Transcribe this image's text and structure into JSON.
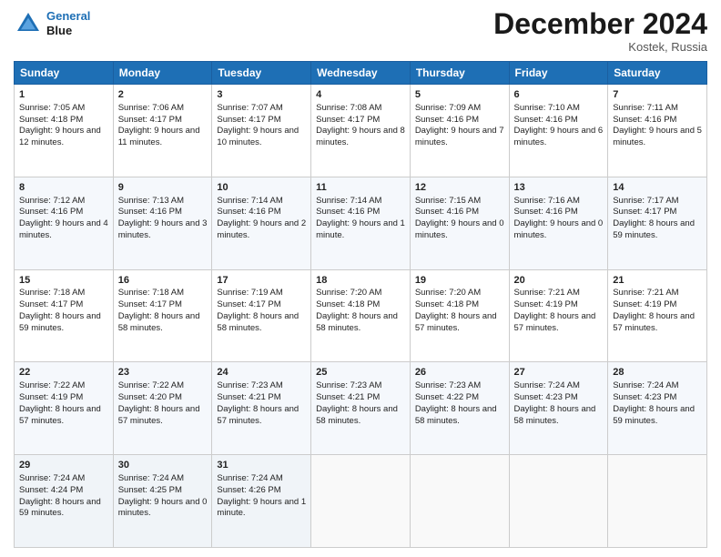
{
  "header": {
    "logo_line1": "General",
    "logo_line2": "Blue",
    "month_title": "December 2024",
    "location": "Kostek, Russia"
  },
  "days_of_week": [
    "Sunday",
    "Monday",
    "Tuesday",
    "Wednesday",
    "Thursday",
    "Friday",
    "Saturday"
  ],
  "weeks": [
    [
      {
        "day": "1",
        "sunrise": "Sunrise: 7:05 AM",
        "sunset": "Sunset: 4:18 PM",
        "daylight": "Daylight: 9 hours and 12 minutes."
      },
      {
        "day": "2",
        "sunrise": "Sunrise: 7:06 AM",
        "sunset": "Sunset: 4:17 PM",
        "daylight": "Daylight: 9 hours and 11 minutes."
      },
      {
        "day": "3",
        "sunrise": "Sunrise: 7:07 AM",
        "sunset": "Sunset: 4:17 PM",
        "daylight": "Daylight: 9 hours and 10 minutes."
      },
      {
        "day": "4",
        "sunrise": "Sunrise: 7:08 AM",
        "sunset": "Sunset: 4:17 PM",
        "daylight": "Daylight: 9 hours and 8 minutes."
      },
      {
        "day": "5",
        "sunrise": "Sunrise: 7:09 AM",
        "sunset": "Sunset: 4:16 PM",
        "daylight": "Daylight: 9 hours and 7 minutes."
      },
      {
        "day": "6",
        "sunrise": "Sunrise: 7:10 AM",
        "sunset": "Sunset: 4:16 PM",
        "daylight": "Daylight: 9 hours and 6 minutes."
      },
      {
        "day": "7",
        "sunrise": "Sunrise: 7:11 AM",
        "sunset": "Sunset: 4:16 PM",
        "daylight": "Daylight: 9 hours and 5 minutes."
      }
    ],
    [
      {
        "day": "8",
        "sunrise": "Sunrise: 7:12 AM",
        "sunset": "Sunset: 4:16 PM",
        "daylight": "Daylight: 9 hours and 4 minutes."
      },
      {
        "day": "9",
        "sunrise": "Sunrise: 7:13 AM",
        "sunset": "Sunset: 4:16 PM",
        "daylight": "Daylight: 9 hours and 3 minutes."
      },
      {
        "day": "10",
        "sunrise": "Sunrise: 7:14 AM",
        "sunset": "Sunset: 4:16 PM",
        "daylight": "Daylight: 9 hours and 2 minutes."
      },
      {
        "day": "11",
        "sunrise": "Sunrise: 7:14 AM",
        "sunset": "Sunset: 4:16 PM",
        "daylight": "Daylight: 9 hours and 1 minute."
      },
      {
        "day": "12",
        "sunrise": "Sunrise: 7:15 AM",
        "sunset": "Sunset: 4:16 PM",
        "daylight": "Daylight: 9 hours and 0 minutes."
      },
      {
        "day": "13",
        "sunrise": "Sunrise: 7:16 AM",
        "sunset": "Sunset: 4:16 PM",
        "daylight": "Daylight: 9 hours and 0 minutes."
      },
      {
        "day": "14",
        "sunrise": "Sunrise: 7:17 AM",
        "sunset": "Sunset: 4:17 PM",
        "daylight": "Daylight: 8 hours and 59 minutes."
      }
    ],
    [
      {
        "day": "15",
        "sunrise": "Sunrise: 7:18 AM",
        "sunset": "Sunset: 4:17 PM",
        "daylight": "Daylight: 8 hours and 59 minutes."
      },
      {
        "day": "16",
        "sunrise": "Sunrise: 7:18 AM",
        "sunset": "Sunset: 4:17 PM",
        "daylight": "Daylight: 8 hours and 58 minutes."
      },
      {
        "day": "17",
        "sunrise": "Sunrise: 7:19 AM",
        "sunset": "Sunset: 4:17 PM",
        "daylight": "Daylight: 8 hours and 58 minutes."
      },
      {
        "day": "18",
        "sunrise": "Sunrise: 7:20 AM",
        "sunset": "Sunset: 4:18 PM",
        "daylight": "Daylight: 8 hours and 58 minutes."
      },
      {
        "day": "19",
        "sunrise": "Sunrise: 7:20 AM",
        "sunset": "Sunset: 4:18 PM",
        "daylight": "Daylight: 8 hours and 57 minutes."
      },
      {
        "day": "20",
        "sunrise": "Sunrise: 7:21 AM",
        "sunset": "Sunset: 4:19 PM",
        "daylight": "Daylight: 8 hours and 57 minutes."
      },
      {
        "day": "21",
        "sunrise": "Sunrise: 7:21 AM",
        "sunset": "Sunset: 4:19 PM",
        "daylight": "Daylight: 8 hours and 57 minutes."
      }
    ],
    [
      {
        "day": "22",
        "sunrise": "Sunrise: 7:22 AM",
        "sunset": "Sunset: 4:19 PM",
        "daylight": "Daylight: 8 hours and 57 minutes."
      },
      {
        "day": "23",
        "sunrise": "Sunrise: 7:22 AM",
        "sunset": "Sunset: 4:20 PM",
        "daylight": "Daylight: 8 hours and 57 minutes."
      },
      {
        "day": "24",
        "sunrise": "Sunrise: 7:23 AM",
        "sunset": "Sunset: 4:21 PM",
        "daylight": "Daylight: 8 hours and 57 minutes."
      },
      {
        "day": "25",
        "sunrise": "Sunrise: 7:23 AM",
        "sunset": "Sunset: 4:21 PM",
        "daylight": "Daylight: 8 hours and 58 minutes."
      },
      {
        "day": "26",
        "sunrise": "Sunrise: 7:23 AM",
        "sunset": "Sunset: 4:22 PM",
        "daylight": "Daylight: 8 hours and 58 minutes."
      },
      {
        "day": "27",
        "sunrise": "Sunrise: 7:24 AM",
        "sunset": "Sunset: 4:23 PM",
        "daylight": "Daylight: 8 hours and 58 minutes."
      },
      {
        "day": "28",
        "sunrise": "Sunrise: 7:24 AM",
        "sunset": "Sunset: 4:23 PM",
        "daylight": "Daylight: 8 hours and 59 minutes."
      }
    ],
    [
      {
        "day": "29",
        "sunrise": "Sunrise: 7:24 AM",
        "sunset": "Sunset: 4:24 PM",
        "daylight": "Daylight: 8 hours and 59 minutes."
      },
      {
        "day": "30",
        "sunrise": "Sunrise: 7:24 AM",
        "sunset": "Sunset: 4:25 PM",
        "daylight": "Daylight: 9 hours and 0 minutes."
      },
      {
        "day": "31",
        "sunrise": "Sunrise: 7:24 AM",
        "sunset": "Sunset: 4:26 PM",
        "daylight": "Daylight: 9 hours and 1 minute."
      },
      null,
      null,
      null,
      null
    ]
  ]
}
